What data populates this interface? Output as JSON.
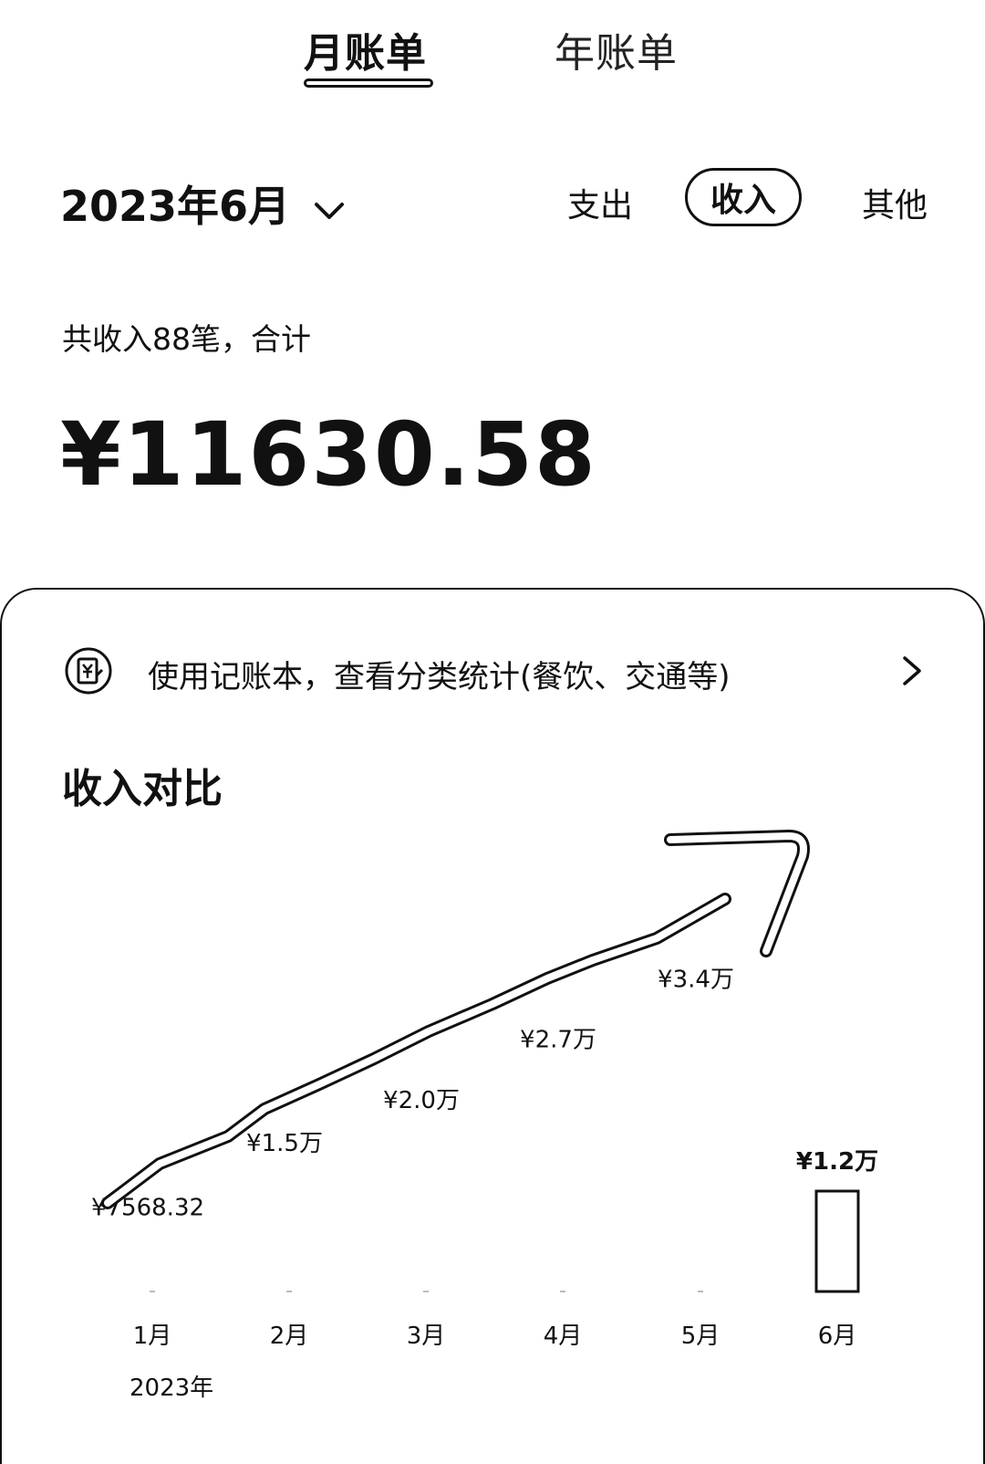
{
  "tabs": [
    {
      "label": "月账单",
      "active": true
    },
    {
      "label": "年账单",
      "active": false
    }
  ],
  "period": {
    "label": "2023年6月"
  },
  "filters": [
    {
      "label": "支出",
      "selected": false
    },
    {
      "label": "收入",
      "selected": true
    },
    {
      "label": "其他",
      "selected": false
    }
  ],
  "summary": {
    "count_text": "共收入88笔，合计",
    "total": "¥11630.58"
  },
  "promo": {
    "text": "使用记账本，查看分类统计(餐饮、交通等)",
    "icon": "ledger-icon",
    "chevron_icon": "chevron-right-icon"
  },
  "section": {
    "title": "收入对比"
  },
  "chart_data": {
    "type": "bar",
    "categories": [
      "1月",
      "2月",
      "3月",
      "4月",
      "5月",
      "6月"
    ],
    "values": [
      7568.32,
      15000,
      20000,
      27000,
      34000,
      11630.58
    ],
    "data_labels": [
      "¥7568.32",
      "¥1.5万",
      "¥2.0万",
      "¥2.7万",
      "¥3.4万",
      "¥1.2万"
    ],
    "x_sublabel": "2023年",
    "highlight_index": 5,
    "annotation": "hand-drawn upward arrow across months 1–5"
  }
}
